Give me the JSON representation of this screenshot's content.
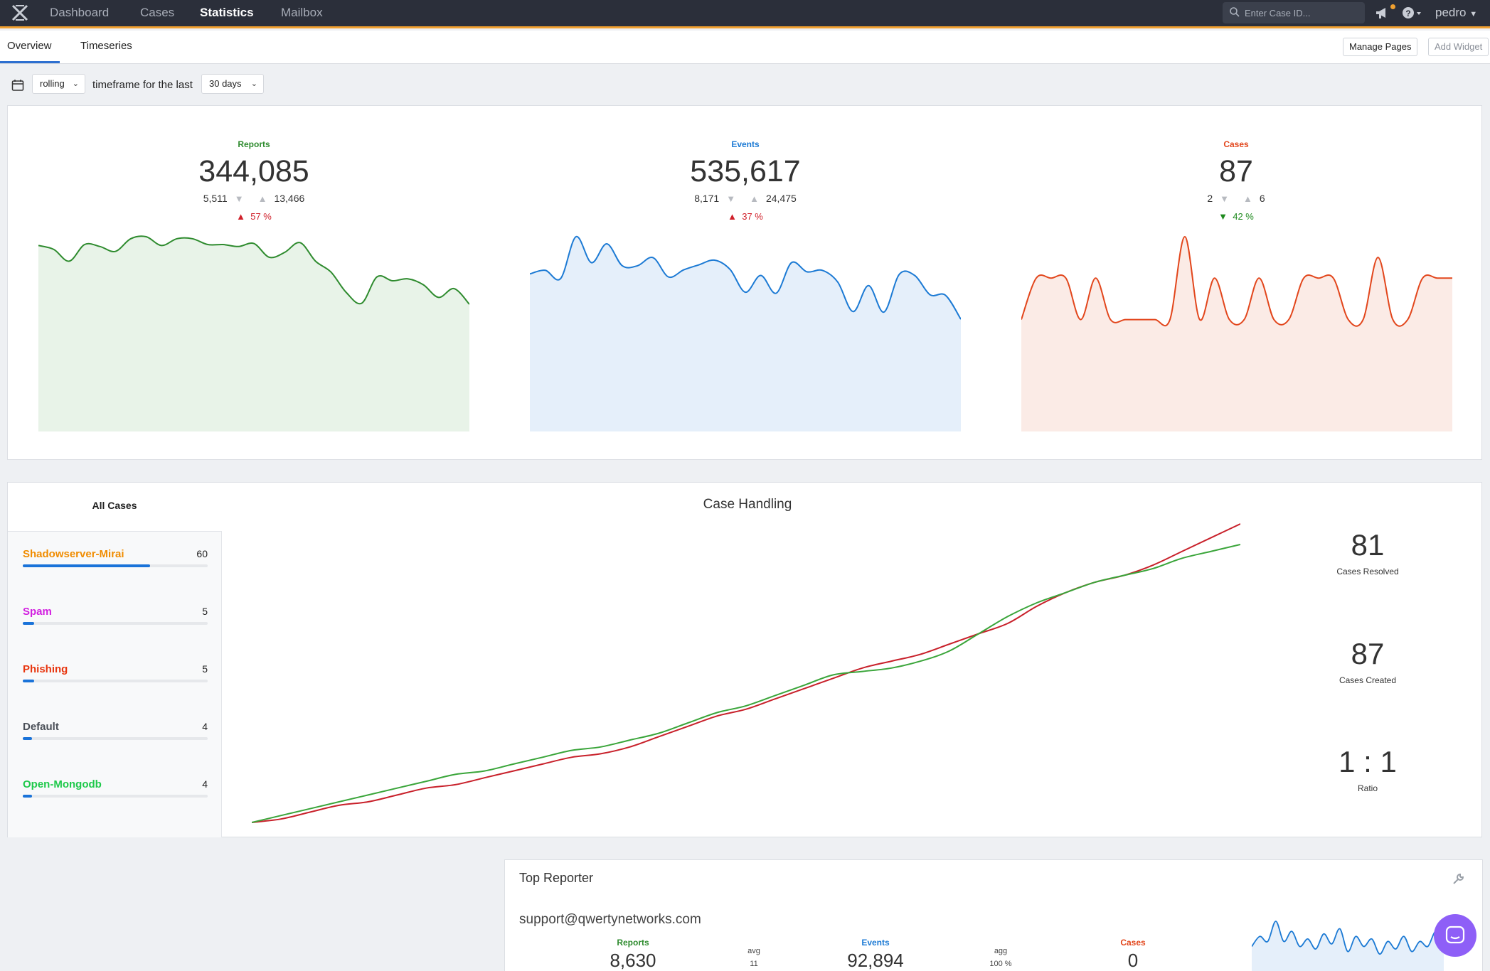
{
  "nav": {
    "items": [
      {
        "label": "Dashboard",
        "active": false
      },
      {
        "label": "Cases",
        "active": false
      },
      {
        "label": "Statistics",
        "active": true
      },
      {
        "label": "Mailbox",
        "active": false
      }
    ],
    "search_placeholder": "Enter Case ID...",
    "user": "pedro",
    "icons": [
      "x-logo-icon",
      "search-icon",
      "megaphone-icon",
      "help-icon"
    ]
  },
  "subnav": {
    "tabs": [
      "Overview",
      "Timeseries"
    ],
    "active_tab": "Overview",
    "manage_pages": "Manage Pages",
    "add_widget": "Add Widget"
  },
  "timeframe": {
    "mode": "rolling",
    "label": "timeframe for the last",
    "period": "30 days"
  },
  "kpis": [
    {
      "title": "Reports",
      "total": "344,085",
      "min": "5,511",
      "max": "13,466",
      "change": "57 %",
      "direction": "up",
      "color": "#2e8b2e",
      "fill": "#e8f3e8",
      "change_color": "#d0212b"
    },
    {
      "title": "Events",
      "total": "535,617",
      "min": "8,171",
      "max": "24,475",
      "change": "37 %",
      "direction": "up",
      "color": "#1c7ad4",
      "fill": "#e5effa",
      "change_color": "#d0212b"
    },
    {
      "title": "Cases",
      "total": "87",
      "min": "2",
      "max": "6",
      "change": "42 %",
      "direction": "down",
      "color": "#e2461c",
      "fill": "#fbebe6",
      "change_color": "#1e8a1e"
    }
  ],
  "chart_data": [
    {
      "type": "area",
      "series": [
        {
          "name": "Reports",
          "values": [
            11800,
            11400,
            10200,
            11900,
            11700,
            11200,
            12500,
            12700,
            11800,
            12500,
            12500,
            11900,
            11900,
            11700,
            12000,
            10600,
            11100,
            12100,
            10200,
            9100,
            7000,
            5900,
            8600,
            8200,
            8400,
            7800,
            6500,
            7400,
            5800
          ]
        }
      ]
    },
    {
      "type": "area",
      "series": [
        {
          "name": "Events",
          "values": [
            17100,
            17800,
            16200,
            24400,
            19300,
            23000,
            18700,
            18700,
            20300,
            16500,
            17900,
            18900,
            19800,
            18000,
            13500,
            16800,
            13300,
            19300,
            17500,
            17800,
            15500,
            9700,
            14800,
            9600,
            17000,
            16800,
            13000,
            12900,
            8200
          ]
        }
      ]
    },
    {
      "type": "area",
      "series": [
        {
          "name": "Cases",
          "values": [
            2,
            4,
            4,
            4,
            2,
            4,
            2,
            2,
            2,
            2,
            2,
            6,
            2,
            4,
            2,
            2,
            4,
            2,
            2,
            4,
            4,
            4,
            2,
            2,
            5,
            2,
            2,
            4,
            4,
            4
          ]
        }
      ]
    },
    {
      "type": "line",
      "title": "Case Handling",
      "series": [
        {
          "name": "Cases Created",
          "values": [
            0,
            1,
            3,
            5,
            6,
            8,
            10,
            11,
            13,
            15,
            17,
            19,
            20,
            22,
            25,
            28,
            31,
            33,
            36,
            39,
            42,
            45,
            47,
            49,
            52,
            55,
            58,
            63,
            67,
            70,
            72,
            75,
            79,
            83,
            87
          ],
          "color": "#c8202a"
        },
        {
          "name": "Cases Resolved",
          "values": [
            0,
            2,
            4,
            6,
            8,
            10,
            12,
            14,
            15,
            17,
            19,
            21,
            22,
            24,
            26,
            29,
            32,
            34,
            37,
            40,
            43,
            44,
            45,
            47,
            50,
            55,
            60,
            64,
            67,
            70,
            72,
            74,
            77,
            79,
            81
          ],
          "color": "#3aa53a"
        }
      ]
    }
  ],
  "all_cases": {
    "title": "All Cases",
    "items": [
      {
        "name": "Shadowserver-Mirai",
        "count": "60",
        "color": "#f08c00",
        "fraction": 0.69
      },
      {
        "name": "Spam",
        "count": "5",
        "color": "#d21fe0",
        "fraction": 0.06
      },
      {
        "name": "Phishing",
        "count": "5",
        "color": "#e8360f",
        "fraction": 0.06
      },
      {
        "name": "Default",
        "count": "4",
        "color": "#4a4f57",
        "fraction": 0.05
      },
      {
        "name": "Open-Mongodb",
        "count": "4",
        "color": "#1ec94a",
        "fraction": 0.05
      }
    ]
  },
  "case_handling": {
    "title": "Case Handling",
    "resolved": "81",
    "resolved_label": "Cases Resolved",
    "created": "87",
    "created_label": "Cases Created",
    "ratio": "1 : 1",
    "ratio_label": "Ratio"
  },
  "top_reporter": {
    "title": "Top Reporter",
    "email": "support@qwertynetworks.com",
    "reports_label": "Reports",
    "reports": "8,630",
    "avg_label": "avg",
    "avg": "11",
    "events_label": "Events",
    "events": "92,894",
    "agg_label": "agg",
    "agg": "100 %",
    "cases_label": "Cases",
    "cases": "0",
    "sparkline": [
      10,
      14,
      12,
      20,
      12,
      16,
      10,
      13,
      9,
      15,
      11,
      17,
      8,
      14,
      10,
      13,
      7,
      12,
      9,
      14,
      8,
      12,
      10,
      16,
      11
    ]
  }
}
